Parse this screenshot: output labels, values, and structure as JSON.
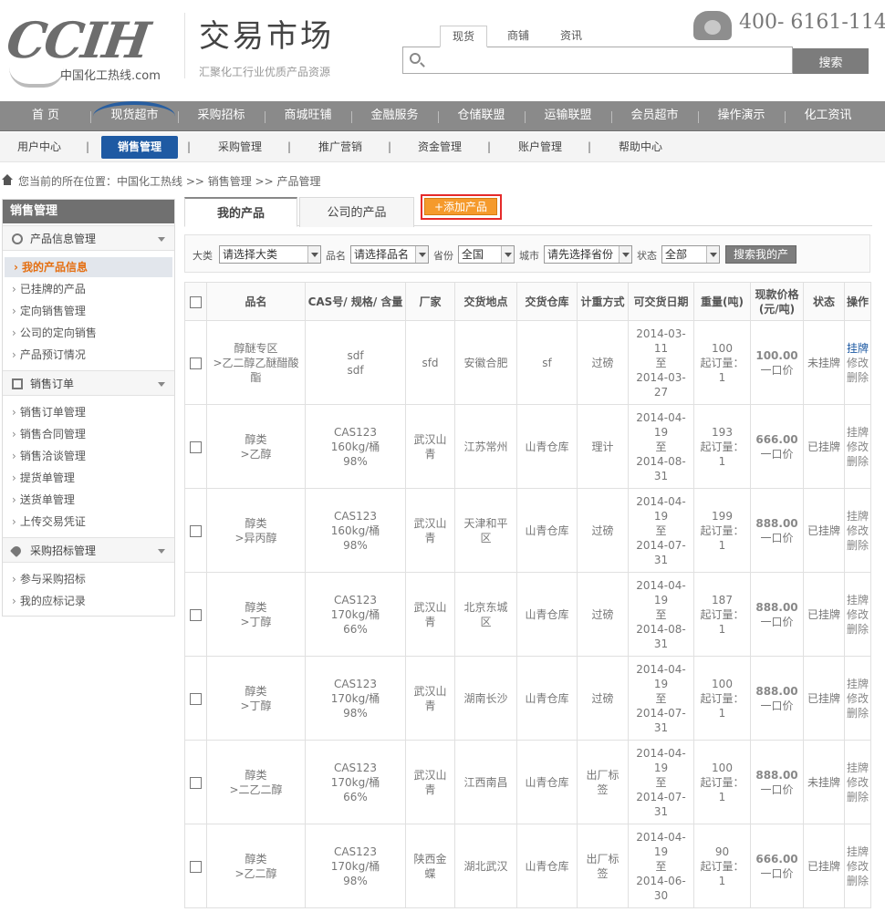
{
  "header": {
    "logo_text": "CCIH",
    "logo_sub": "中国化工热线.com",
    "market_title": "交易市场",
    "market_sub": "汇聚化工行业优质产品资源",
    "search_tabs": [
      "现货",
      "商铺",
      "资讯"
    ],
    "search_placeholder": "",
    "search_button": "搜索",
    "phone": "400- 6161-114"
  },
  "mainnav": [
    "首  页",
    "现货超市",
    "采购招标",
    "商城旺铺",
    "金融服务",
    "仓储联盟",
    "运输联盟",
    "会员超市",
    "操作演示",
    "化工资讯"
  ],
  "subnav": [
    "用户中心",
    "销售管理",
    "采购管理",
    "推广营销",
    "资金管理",
    "账户管理",
    "帮助中心"
  ],
  "breadcrumb": "您当前的所在位置：中国化工热线 >> 销售管理 >> 产品管理",
  "sidebar": {
    "title": "销售管理",
    "groups": [
      {
        "label": "产品信息管理",
        "items": [
          "我的产品信息",
          "已挂牌的产品",
          "定向销售管理",
          "公司的定向销售",
          "产品预订情况"
        ]
      },
      {
        "label": "销售订单",
        "items": [
          "销售订单管理",
          "销售合同管理",
          "销售洽谈管理",
          "提货单管理",
          "送货单管理",
          "上传交易凭证"
        ]
      },
      {
        "label": "采购招标管理",
        "items": [
          "参与采购招标",
          "我的应标记录"
        ]
      }
    ]
  },
  "tabs": {
    "mine": "我的产品",
    "company": "公司的产品",
    "add": "+添加产品"
  },
  "filter": {
    "l1": "大类",
    "v1": "请选择大类",
    "l2": "品名",
    "v2": "请选择品名",
    "l3": "省份",
    "v3": "全国",
    "l4": "城市",
    "v4": "请先选择省份",
    "l5": "状态",
    "v5": "全部",
    "search": "搜索我的产"
  },
  "table": {
    "headers": [
      "品名",
      "CAS号/ 规格/ 含量",
      "厂家",
      "交货地点",
      "交货仓库",
      "计重方式",
      "可交货日期",
      "重量(吨)",
      "现款价格(元/吨)",
      "状态",
      "操作"
    ],
    "rows": [
      {
        "name": "醇醚专区\n>乙二醇乙醚醋酸酯",
        "cas": "sdf\nsdf",
        "maker": "sfd",
        "place": "安徽合肥",
        "store": "sf",
        "method": "过磅",
        "date": "2014-03-\n11\n至\n2014-03-\n27",
        "weight": "100\n起订量：\n1",
        "price": "100.00",
        "ptype": "一口价",
        "status": "未挂牌",
        "ops": [
          "挂牌",
          "修改",
          "删除"
        ]
      },
      {
        "name": "醇类\n>乙醇",
        "cas": "CAS123\n160kg/桶\n98%",
        "maker": "武汉山\n青",
        "place": "江苏常州",
        "store": "山青仓库",
        "method": "理计",
        "date": "2014-04-\n19\n至\n2014-08-\n31",
        "weight": "193\n起订量：\n1",
        "price": "666.00",
        "ptype": "一口价",
        "status": "已挂牌",
        "ops": [
          "挂牌",
          "修改",
          "删除"
        ]
      },
      {
        "name": "醇类\n>异丙醇",
        "cas": "CAS123\n160kg/桶\n98%",
        "maker": "武汉山\n青",
        "place": "天津和平\n区",
        "store": "山青仓库",
        "method": "过磅",
        "date": "2014-04-\n19\n至\n2014-07-\n31",
        "weight": "199\n起订量：\n1",
        "price": "888.00",
        "ptype": "一口价",
        "status": "已挂牌",
        "ops": [
          "挂牌",
          "修改",
          "删除"
        ]
      },
      {
        "name": "醇类\n>丁醇",
        "cas": "CAS123\n170kg/桶\n66%",
        "maker": "武汉山\n青",
        "place": "北京东城\n区",
        "store": "山青仓库",
        "method": "过磅",
        "date": "2014-04-\n19\n至\n2014-08-\n31",
        "weight": "187\n起订量：\n1",
        "price": "888.00",
        "ptype": "一口价",
        "status": "已挂牌",
        "ops": [
          "挂牌",
          "修改",
          "删除"
        ]
      },
      {
        "name": "醇类\n>丁醇",
        "cas": "CAS123\n170kg/桶\n98%",
        "maker": "武汉山\n青",
        "place": "湖南长沙",
        "store": "山青仓库",
        "method": "过磅",
        "date": "2014-04-\n19\n至\n2014-07-\n31",
        "weight": "100\n起订量：\n1",
        "price": "888.00",
        "ptype": "一口价",
        "status": "已挂牌",
        "ops": [
          "挂牌",
          "修改",
          "删除"
        ]
      },
      {
        "name": "醇类\n>二乙二醇",
        "cas": "CAS123\n170kg/桶\n66%",
        "maker": "武汉山\n青",
        "place": "江西南昌",
        "store": "山青仓库",
        "method": "出厂标\n签",
        "date": "2014-04-\n19\n至\n2014-07-\n31",
        "weight": "100\n起订量：\n1",
        "price": "888.00",
        "ptype": "一口价",
        "status": "未挂牌",
        "ops": [
          "挂牌",
          "修改",
          "删除"
        ]
      },
      {
        "name": "醇类\n>乙二醇",
        "cas": "CAS123\n170kg/桶\n98%",
        "maker": "陕西金\n蝶",
        "place": "湖北武汉",
        "store": "山青仓库",
        "method": "出厂标\n签",
        "date": "2014-04-\n19\n至\n2014-06-\n30",
        "weight": "90\n起订量：\n1",
        "price": "666.00",
        "ptype": "一口价",
        "status": "已挂牌",
        "ops": [
          "挂牌",
          "修改",
          "删除"
        ]
      }
    ]
  }
}
